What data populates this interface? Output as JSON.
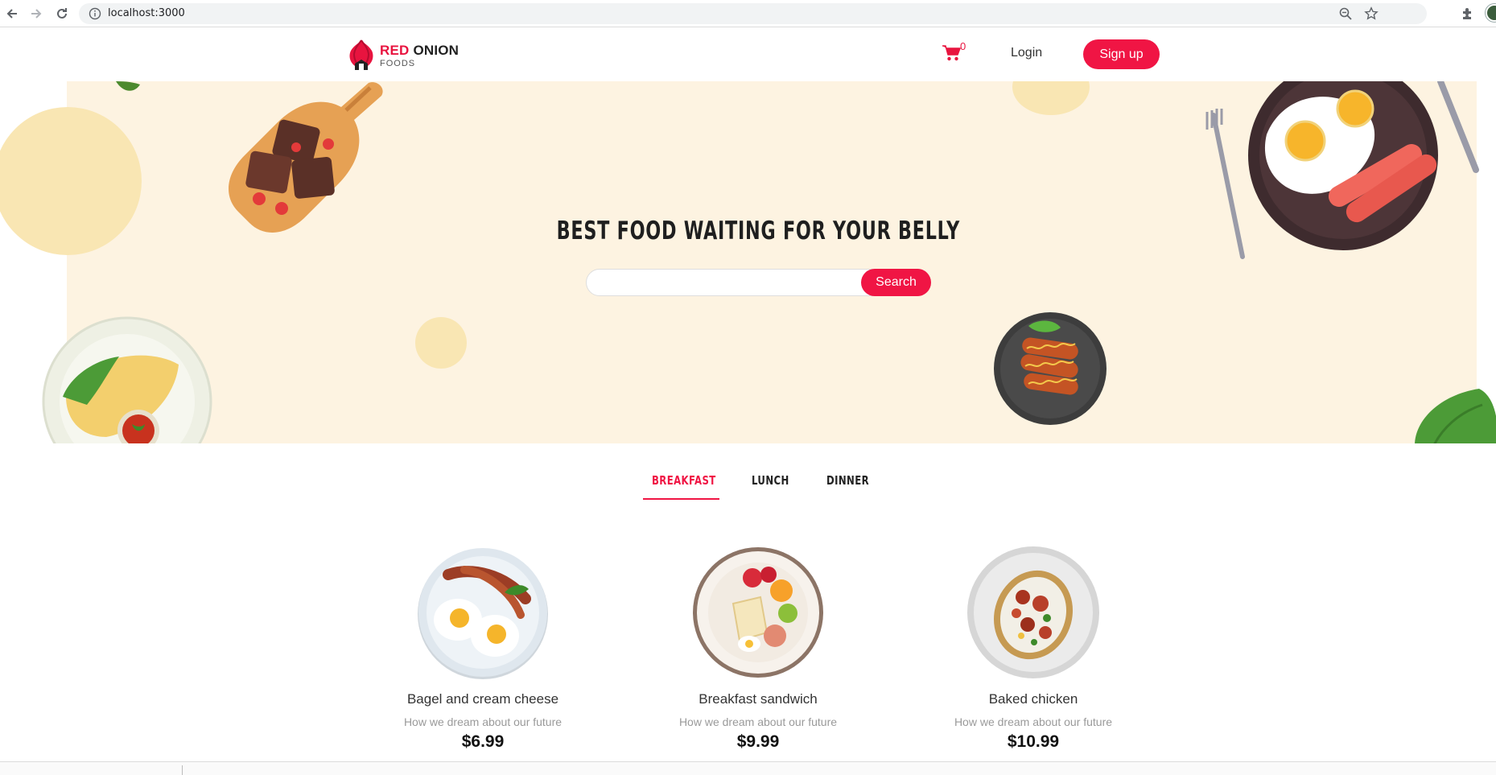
{
  "browser": {
    "url": "localhost:3000",
    "icons": [
      "back-arrow-icon",
      "forward-arrow-icon",
      "reload-icon",
      "info-icon",
      "zoom-icon",
      "star-icon",
      "extensions-icon",
      "profile-avatar"
    ]
  },
  "header": {
    "logo": {
      "word1": "RED",
      "word2": "ONION",
      "sub": "FOODS"
    },
    "cart_count": "0",
    "login_label": "Login",
    "signup_label": "Sign up"
  },
  "hero": {
    "title": "BEST FOOD WAITING FOR YOUR BELLY",
    "search": {
      "placeholder": "",
      "value": "",
      "button_label": "Search"
    }
  },
  "tabs": [
    {
      "label": "BREAKFAST",
      "active": true
    },
    {
      "label": "LUNCH",
      "active": false
    },
    {
      "label": "DINNER",
      "active": false
    }
  ],
  "foods": [
    {
      "name": "Bagel and cream cheese",
      "description": "How we dream about our future",
      "price": "$6.99"
    },
    {
      "name": "Breakfast sandwich",
      "description": "How we dream about our future",
      "price": "$9.99"
    },
    {
      "name": "Baked chicken",
      "description": "How we dream about our future",
      "price": "$10.99"
    }
  ],
  "colors": {
    "accent": "#f01544",
    "hero_background": "#fdf3e1",
    "circle": "#f9e6b3"
  }
}
